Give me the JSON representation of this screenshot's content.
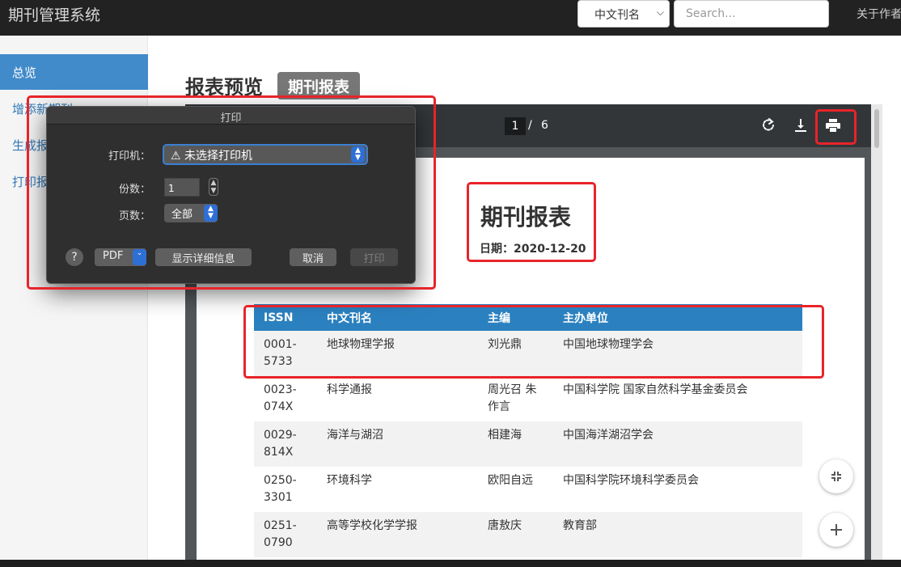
{
  "app": {
    "title": "期刊管理系统"
  },
  "nav": {
    "search_field_select": "中文刊名",
    "search_placeholder": "Search...",
    "about": "关于作者"
  },
  "sidebar": {
    "items": [
      {
        "label": "总览",
        "active": true
      },
      {
        "label": "增添新期刊"
      },
      {
        "label": "生成报表"
      },
      {
        "label": "打印报表"
      }
    ]
  },
  "main": {
    "title": "报表预览",
    "badge": "期刊报表"
  },
  "pdf_viewer": {
    "current_page": "1",
    "separator": "/",
    "total_pages": "6",
    "icons": [
      "rotate-icon",
      "download-icon",
      "print-icon",
      "fit-page-icon",
      "zoom-in-icon"
    ],
    "report": {
      "title": "期刊报表",
      "date": "日期：2020-12-20",
      "headers": [
        "ISSN",
        "中文刊名",
        "主编",
        "主办单位"
      ],
      "rows": [
        {
          "issn": "0001-5733",
          "name": "地球物理学报",
          "editor": "刘光鼎",
          "sponsor": "中国地球物理学会"
        },
        {
          "issn": "0023-074X",
          "name": "科学通报",
          "editor": "周光召 朱作言",
          "sponsor": "中国科学院 国家自然科学基金委员会"
        },
        {
          "issn": "0029-814X",
          "name": "海洋与湖沼",
          "editor": "相建海",
          "sponsor": "中国海洋湖沼学会"
        },
        {
          "issn": "0250-3301",
          "name": "环境科学",
          "editor": "欧阳自远",
          "sponsor": "中国科学院环境科学委员会"
        },
        {
          "issn": "0251-0790",
          "name": "高等学校化学学报",
          "editor": "唐敖庆",
          "sponsor": "教育部"
        }
      ]
    }
  },
  "print_dialog": {
    "title": "打印",
    "printer_label": "打印机：",
    "printer_value": "⚠ 未选择打印机",
    "copies_label": "份数：",
    "copies_value": "1",
    "pages_label": "页数：",
    "pages_value": "全部",
    "help": "?",
    "pdf": "PDF",
    "details": "显示详细信息",
    "cancel": "取消",
    "print": "打印"
  },
  "colors": {
    "annotation": "#e8242a",
    "table_header": "#2b81bf",
    "sidebar_active": "#428bca"
  }
}
